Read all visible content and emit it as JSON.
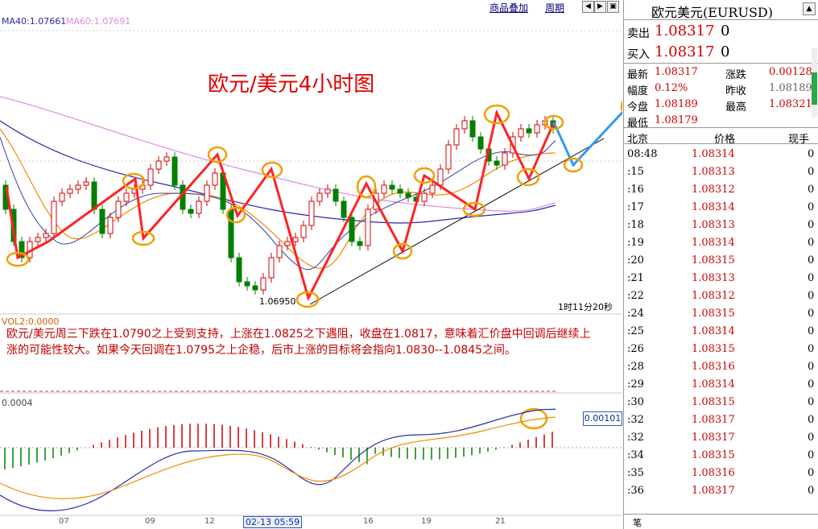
{
  "toolbar": {
    "overlay_label": "商品叠加",
    "period_label": "周期",
    "ma40": "MA40:1.07661",
    "ma60": "MA60:1.07691"
  },
  "chart": {
    "title": "欧元/美元4小时图",
    "low_label": "1.06950",
    "time_remaining": "1时11分20秒",
    "vol_label": "VOL2:0.0000",
    "comment": "欧元/美元周三下跌在1.0790之上受到支持，上涨在1.0825之下遇阻，收盘在1.0817，意味着汇价盘中回调后继续上涨的可能性较大。如果今天回调在1.0795之上企稳，后市上涨的目标将会指向1.0830--1.0845之间。",
    "macd_scale": "0.0004",
    "macd_value": "0.00101",
    "cursor_date": "02-13 05:59",
    "xticks": [
      "07",
      "09",
      "12",
      "16",
      "19",
      "21"
    ],
    "colors": {
      "up": "#d00000",
      "down": "#008000",
      "annotation": "#ff2222",
      "circle": "#f0a000",
      "projection": "#3399ee"
    }
  },
  "panel": {
    "title": "欧元美元(EURUSD)",
    "sell_label": "卖出",
    "sell_value": "1.08317",
    "sell_qty": "0",
    "buy_label": "买入",
    "buy_value": "1.08317",
    "buy_qty": "0",
    "stats": [
      {
        "k1": "最新",
        "v1": "1.08317",
        "k2": "涨跌",
        "v2": "0.00128"
      },
      {
        "k1": "幅度",
        "v1": "0.12%",
        "k2": "昨收",
        "v2": "1.08189"
      },
      {
        "k1": "今盘",
        "v1": "1.08189",
        "k2": "最高",
        "v2": "1.08321"
      },
      {
        "k1": "最低",
        "v1": "1.08179",
        "k2": "",
        "v2": ""
      }
    ],
    "tick_head": {
      "time": "北京",
      "price": "价格",
      "qty": "现手"
    },
    "ticks": [
      {
        "t": "08:48",
        "p": "1.08314",
        "q": "0"
      },
      {
        "t": ":15",
        "p": "1.08313",
        "q": "0"
      },
      {
        "t": ":16",
        "p": "1.08312",
        "q": "0"
      },
      {
        "t": ":17",
        "p": "1.08314",
        "q": "0"
      },
      {
        "t": ":18",
        "p": "1.08313",
        "q": "0"
      },
      {
        "t": ":19",
        "p": "1.08314",
        "q": "0"
      },
      {
        "t": ":20",
        "p": "1.08315",
        "q": "0"
      },
      {
        "t": ":21",
        "p": "1.08313",
        "q": "0"
      },
      {
        "t": ":22",
        "p": "1.08312",
        "q": "0"
      },
      {
        "t": ":24",
        "p": "1.08315",
        "q": "0"
      },
      {
        "t": ":25",
        "p": "1.08314",
        "q": "0"
      },
      {
        "t": ":26",
        "p": "1.08315",
        "q": "0"
      },
      {
        "t": ":28",
        "p": "1.08316",
        "q": "0"
      },
      {
        "t": ":29",
        "p": "1.08314",
        "q": "0"
      },
      {
        "t": ":30",
        "p": "1.08315",
        "q": "0"
      },
      {
        "t": ":32",
        "p": "1.08317",
        "q": "0"
      },
      {
        "t": ":32",
        "p": "1.08317",
        "q": "0"
      },
      {
        "t": ":34",
        "p": "1.08315",
        "q": "0"
      },
      {
        "t": ":35",
        "p": "1.08316",
        "q": "0"
      },
      {
        "t": ":36",
        "p": "1.08317",
        "q": "0"
      }
    ],
    "bottom_tab": "笔"
  }
}
